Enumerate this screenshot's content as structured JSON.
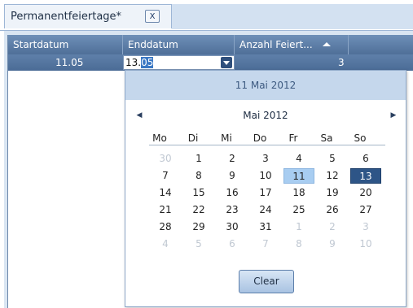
{
  "tab": {
    "title": "Permanentfeiertage*",
    "close_label": "X"
  },
  "grid": {
    "columns": [
      "Startdatum",
      "Enddatum",
      "Anzahl Feiert..."
    ],
    "row": {
      "startdatum": "11.05",
      "enddatum_prefix": "13.",
      "enddatum_selected": "05",
      "anzahl": "3"
    }
  },
  "calendar": {
    "header": "11 Mai 2012",
    "month": "Mai 2012",
    "prev": "◀",
    "next": "▶",
    "weekdays": [
      "Mo",
      "Di",
      "Mi",
      "Do",
      "Fr",
      "Sa",
      "So"
    ],
    "weeks": [
      [
        "30",
        "1",
        "2",
        "3",
        "4",
        "5",
        "6"
      ],
      [
        "7",
        "8",
        "9",
        "10",
        "11",
        "12",
        "13"
      ],
      [
        "14",
        "15",
        "16",
        "17",
        "18",
        "19",
        "20"
      ],
      [
        "21",
        "22",
        "23",
        "24",
        "25",
        "26",
        "27"
      ],
      [
        "28",
        "29",
        "30",
        "31",
        "1",
        "2",
        "3"
      ],
      [
        "4",
        "5",
        "6",
        "7",
        "8",
        "9",
        "10"
      ]
    ],
    "clear_label": "Clear"
  },
  "colors": {
    "accent": "#2e5587",
    "hover": "#a8cdf1",
    "header_bg": "#c5d7ec"
  }
}
